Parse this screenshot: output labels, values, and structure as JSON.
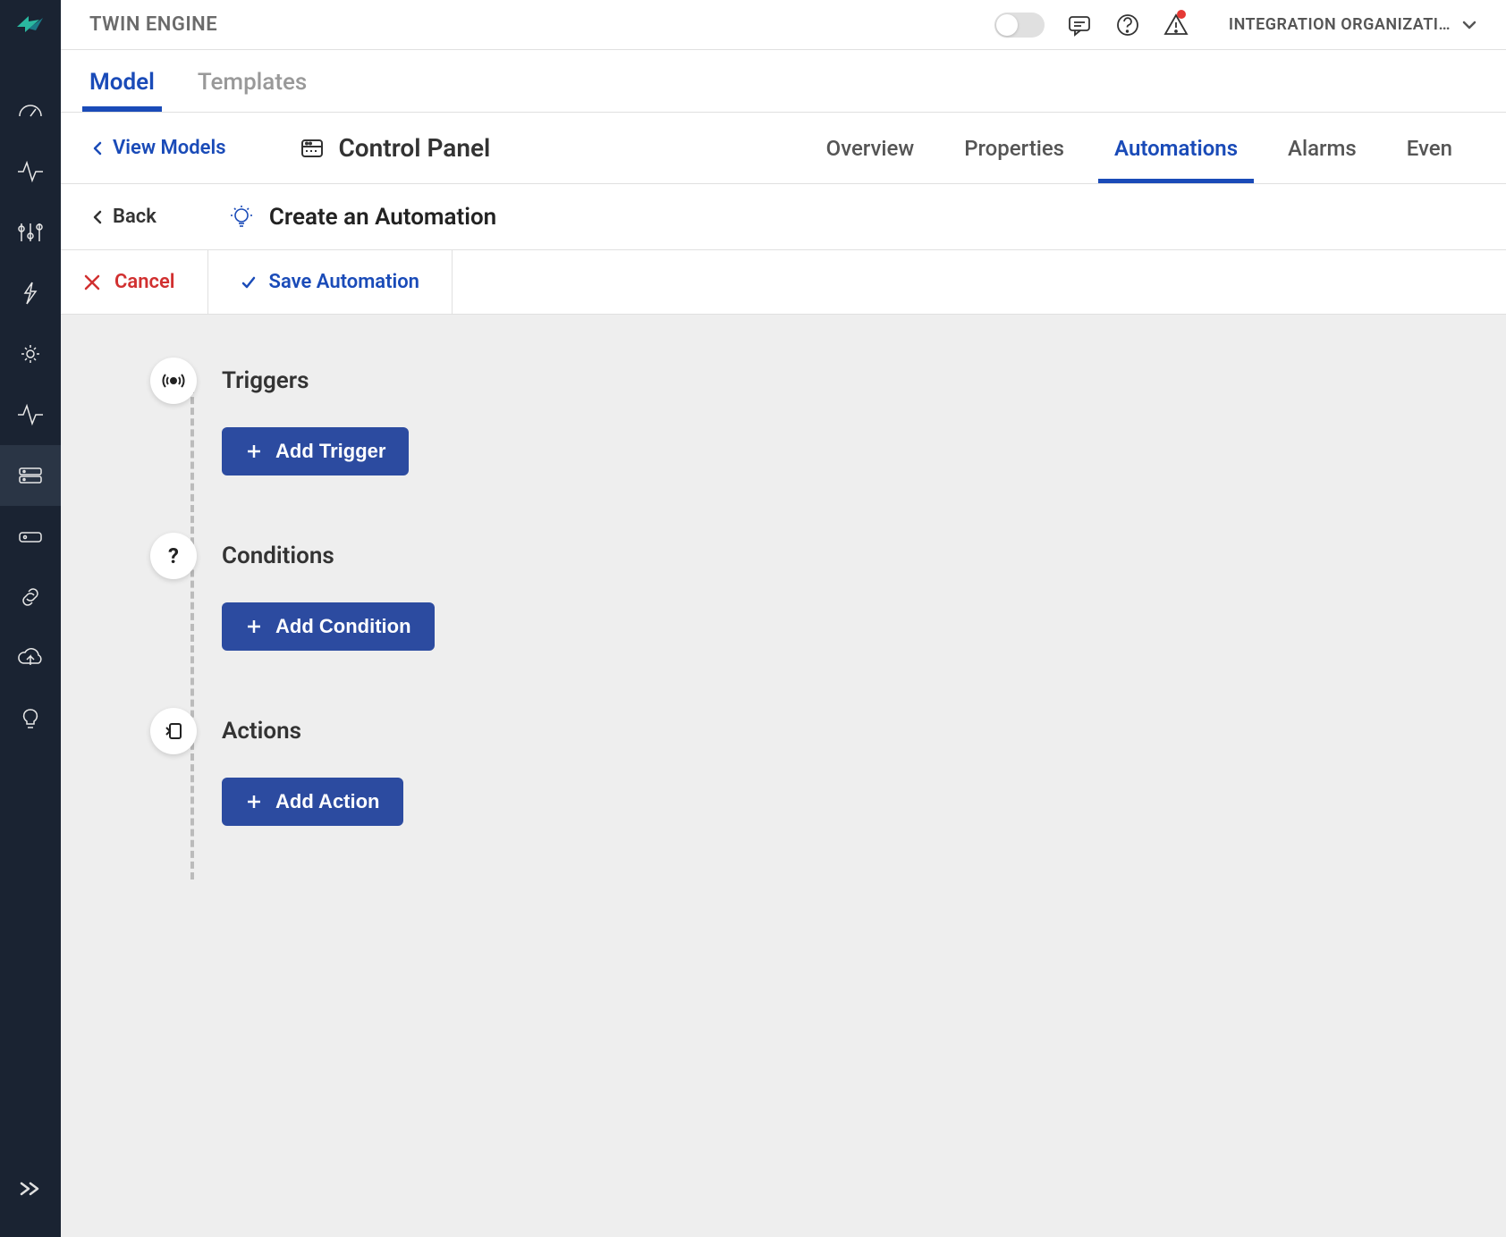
{
  "app": {
    "title": "TWIN ENGINE"
  },
  "header": {
    "org_label": "INTEGRATION ORGANIZATI…"
  },
  "primaryTabs": {
    "model": "Model",
    "templates": "Templates"
  },
  "secondary": {
    "view_models": "View Models",
    "page_title": "Control Panel",
    "tabs": {
      "overview": "Overview",
      "properties": "Properties",
      "automations": "Automations",
      "alarms": "Alarms",
      "events": "Even"
    }
  },
  "tertiary": {
    "back": "Back",
    "title": "Create an Automation"
  },
  "actions": {
    "cancel": "Cancel",
    "save": "Save Automation"
  },
  "builder": {
    "triggers": {
      "title": "Triggers",
      "add_label": "Add Trigger"
    },
    "conditions": {
      "title": "Conditions",
      "add_label": "Add Condition"
    },
    "actions": {
      "title": "Actions",
      "add_label": "Add Action"
    }
  }
}
